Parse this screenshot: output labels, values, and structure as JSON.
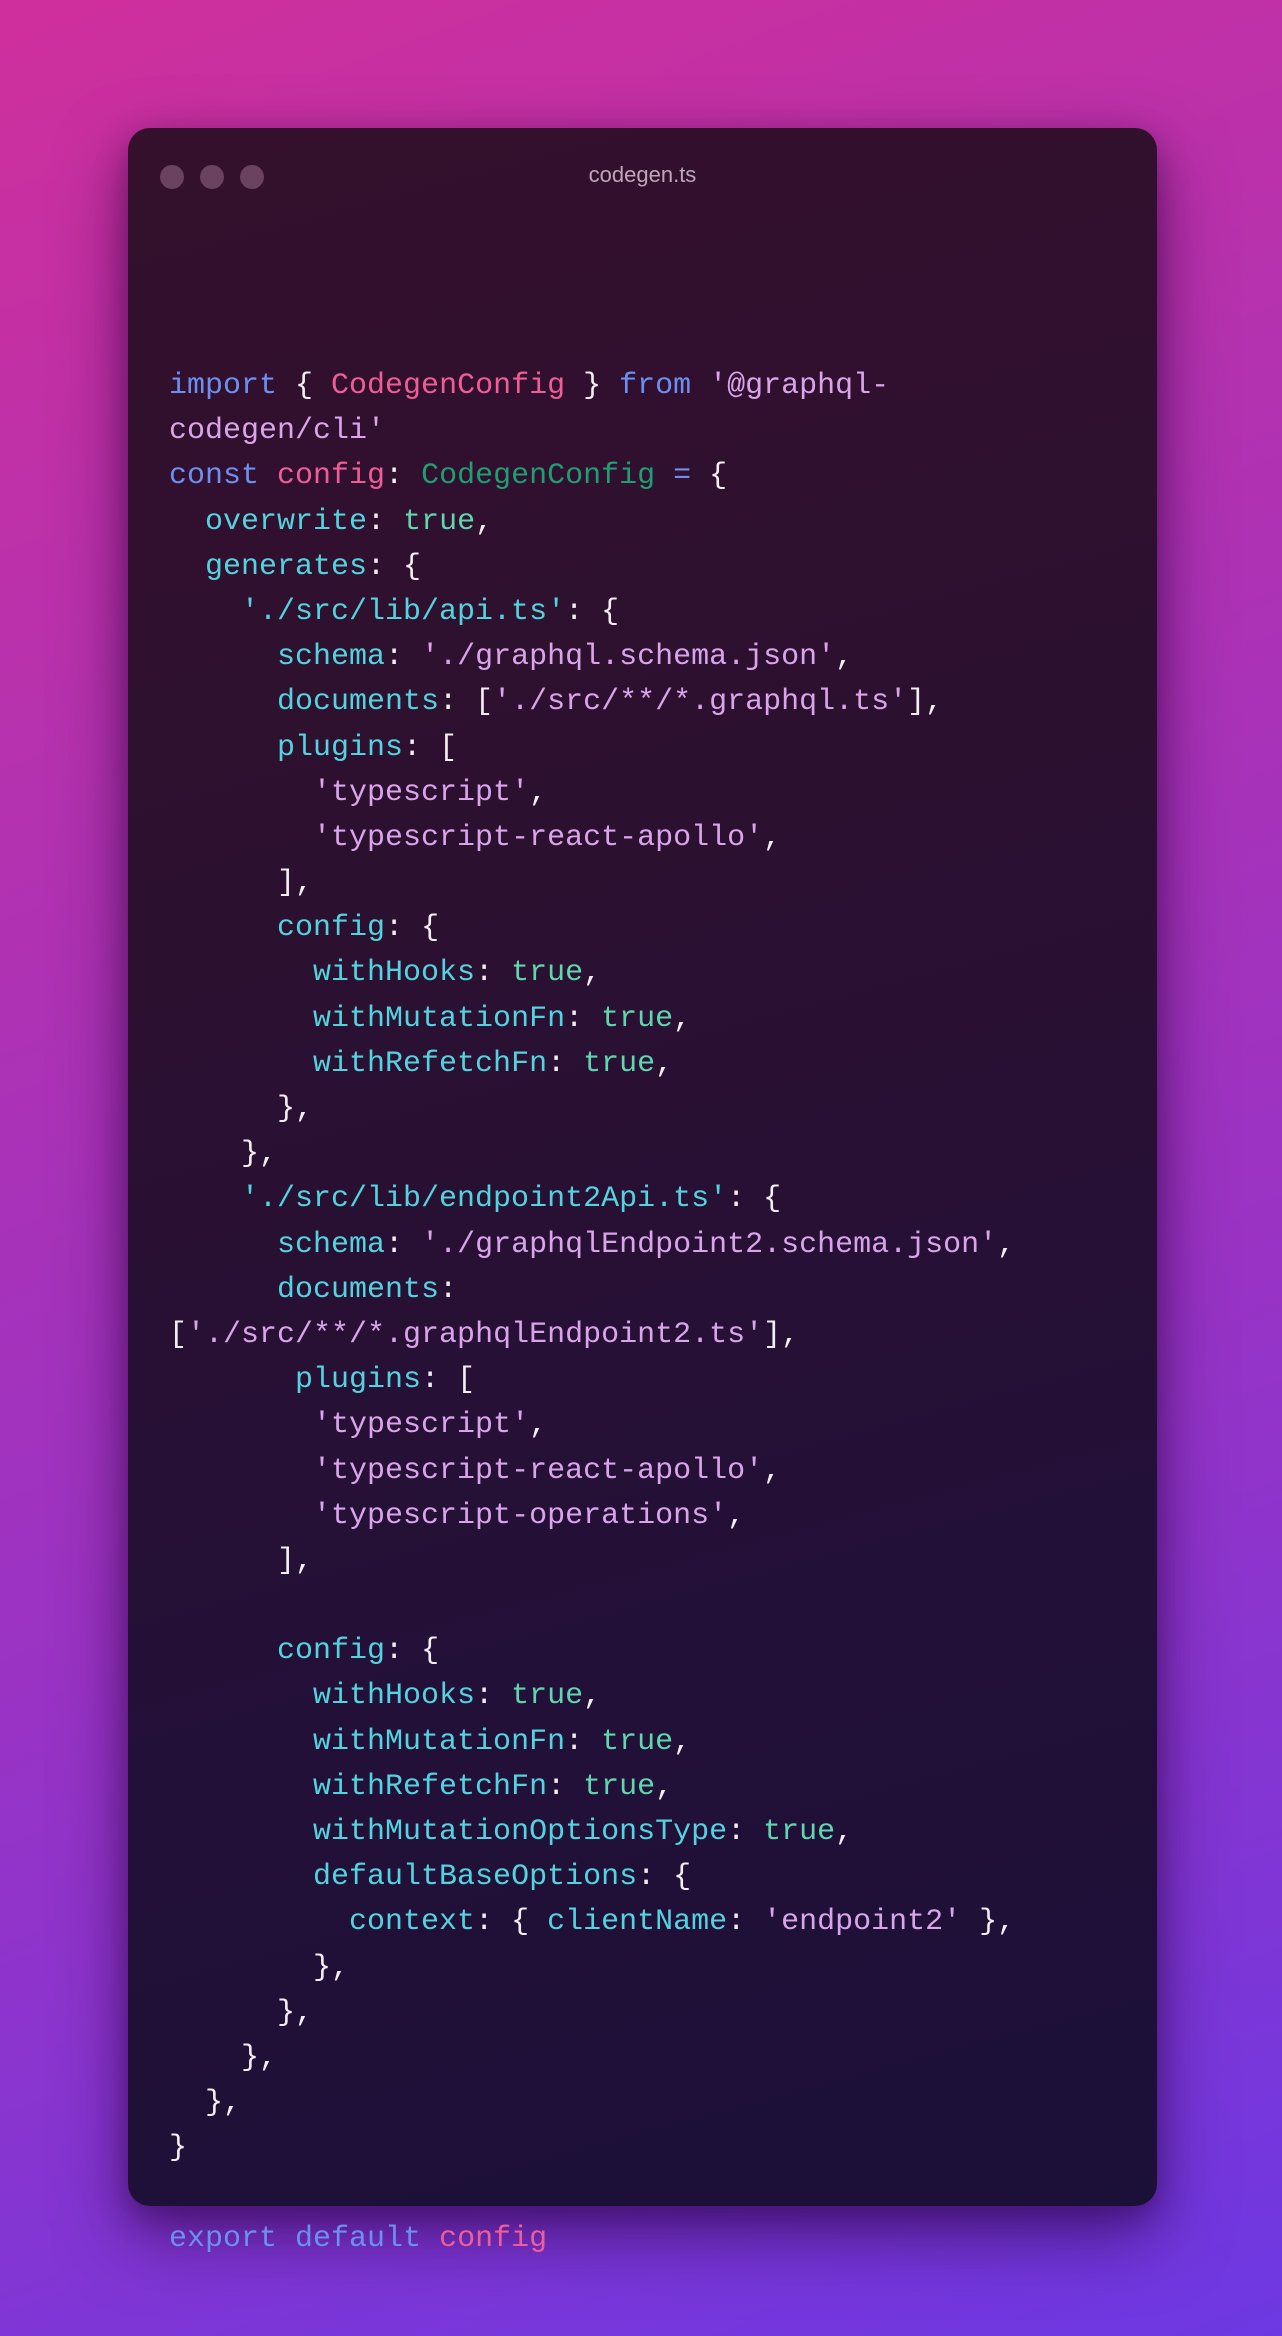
{
  "window": {
    "title": "codegen.ts",
    "controls": [
      "close",
      "minimize",
      "maximize"
    ]
  },
  "colors": {
    "keyword": "#6d8ff0",
    "identifier": "#ef5d98",
    "type": "#1f9e72",
    "property": "#52d3dd",
    "string": "#d9a4ea",
    "boolean": "#5fd6ad",
    "punctuation": "#f4eef2"
  },
  "code": {
    "language": "typescript",
    "lines": [
      [
        [
          "kw",
          "import"
        ],
        [
          "pun",
          " { "
        ],
        [
          "tp",
          "CodegenConfig"
        ],
        [
          "pun",
          " } "
        ],
        [
          "kw",
          "from"
        ],
        [
          "pun",
          " "
        ],
        [
          "str",
          "'@graphql-"
        ]
      ],
      [
        [
          "str",
          "codegen/cli'"
        ]
      ],
      [
        [
          "kw",
          "const"
        ],
        [
          "pun",
          " "
        ],
        [
          "tp",
          "config"
        ],
        [
          "pun",
          ": "
        ],
        [
          "ty",
          "CodegenConfig"
        ],
        [
          "pun",
          " "
        ],
        [
          "kw",
          "="
        ],
        [
          "pun",
          " {"
        ]
      ],
      [
        [
          "pun",
          "  "
        ],
        [
          "prop",
          "overwrite"
        ],
        [
          "pun",
          ": "
        ],
        [
          "bool",
          "true"
        ],
        [
          "pun",
          ","
        ]
      ],
      [
        [
          "pun",
          "  "
        ],
        [
          "prop",
          "generates"
        ],
        [
          "pun",
          ": {"
        ]
      ],
      [
        [
          "pun",
          "    "
        ],
        [
          "prop",
          "'./src/lib/api.ts'"
        ],
        [
          "pun",
          ": {"
        ]
      ],
      [
        [
          "pun",
          "      "
        ],
        [
          "prop",
          "schema"
        ],
        [
          "pun",
          ": "
        ],
        [
          "str",
          "'./graphql.schema.json'"
        ],
        [
          "pun",
          ","
        ]
      ],
      [
        [
          "pun",
          "      "
        ],
        [
          "prop",
          "documents"
        ],
        [
          "pun",
          ": ["
        ],
        [
          "str",
          "'./src/**/*.graphql.ts'"
        ],
        [
          "pun",
          "],"
        ]
      ],
      [
        [
          "pun",
          "      "
        ],
        [
          "prop",
          "plugins"
        ],
        [
          "pun",
          ": ["
        ]
      ],
      [
        [
          "pun",
          "        "
        ],
        [
          "str",
          "'typescript'"
        ],
        [
          "pun",
          ","
        ]
      ],
      [
        [
          "pun",
          "        "
        ],
        [
          "str",
          "'typescript-react-apollo'"
        ],
        [
          "pun",
          ","
        ]
      ],
      [
        [
          "pun",
          "      ],"
        ]
      ],
      [
        [
          "pun",
          "      "
        ],
        [
          "prop",
          "config"
        ],
        [
          "pun",
          ": {"
        ]
      ],
      [
        [
          "pun",
          "        "
        ],
        [
          "prop",
          "withHooks"
        ],
        [
          "pun",
          ": "
        ],
        [
          "bool",
          "true"
        ],
        [
          "pun",
          ","
        ]
      ],
      [
        [
          "pun",
          "        "
        ],
        [
          "prop",
          "withMutationFn"
        ],
        [
          "pun",
          ": "
        ],
        [
          "bool",
          "true"
        ],
        [
          "pun",
          ","
        ]
      ],
      [
        [
          "pun",
          "        "
        ],
        [
          "prop",
          "withRefetchFn"
        ],
        [
          "pun",
          ": "
        ],
        [
          "bool",
          "true"
        ],
        [
          "pun",
          ","
        ]
      ],
      [
        [
          "pun",
          "      },"
        ]
      ],
      [
        [
          "pun",
          "    },"
        ]
      ],
      [
        [
          "pun",
          "    "
        ],
        [
          "prop",
          "'./src/lib/endpoint2Api.ts'"
        ],
        [
          "pun",
          ": {"
        ]
      ],
      [
        [
          "pun",
          "      "
        ],
        [
          "prop",
          "schema"
        ],
        [
          "pun",
          ": "
        ],
        [
          "str",
          "'./graphqlEndpoint2.schema.json'"
        ],
        [
          "pun",
          ","
        ]
      ],
      [
        [
          "pun",
          "      "
        ],
        [
          "prop",
          "documents"
        ],
        [
          "pun",
          ":"
        ]
      ],
      [
        [
          "pun",
          "["
        ],
        [
          "str",
          "'./src/**/*.graphqlEndpoint2.ts'"
        ],
        [
          "pun",
          "],"
        ]
      ],
      [
        [
          "pun",
          "       "
        ],
        [
          "prop",
          "plugins"
        ],
        [
          "pun",
          ": ["
        ]
      ],
      [
        [
          "pun",
          "        "
        ],
        [
          "str",
          "'typescript'"
        ],
        [
          "pun",
          ","
        ]
      ],
      [
        [
          "pun",
          "        "
        ],
        [
          "str",
          "'typescript-react-apollo'"
        ],
        [
          "pun",
          ","
        ]
      ],
      [
        [
          "pun",
          "        "
        ],
        [
          "str",
          "'typescript-operations'"
        ],
        [
          "pun",
          ","
        ]
      ],
      [
        [
          "pun",
          "      ],"
        ]
      ],
      [],
      [
        [
          "pun",
          "      "
        ],
        [
          "prop",
          "config"
        ],
        [
          "pun",
          ": {"
        ]
      ],
      [
        [
          "pun",
          "        "
        ],
        [
          "prop",
          "withHooks"
        ],
        [
          "pun",
          ": "
        ],
        [
          "bool",
          "true"
        ],
        [
          "pun",
          ","
        ]
      ],
      [
        [
          "pun",
          "        "
        ],
        [
          "prop",
          "withMutationFn"
        ],
        [
          "pun",
          ": "
        ],
        [
          "bool",
          "true"
        ],
        [
          "pun",
          ","
        ]
      ],
      [
        [
          "pun",
          "        "
        ],
        [
          "prop",
          "withRefetchFn"
        ],
        [
          "pun",
          ": "
        ],
        [
          "bool",
          "true"
        ],
        [
          "pun",
          ","
        ]
      ],
      [
        [
          "pun",
          "        "
        ],
        [
          "prop",
          "withMutationOptionsType"
        ],
        [
          "pun",
          ": "
        ],
        [
          "bool",
          "true"
        ],
        [
          "pun",
          ","
        ]
      ],
      [
        [
          "pun",
          "        "
        ],
        [
          "prop",
          "defaultBaseOptions"
        ],
        [
          "pun",
          ": {"
        ]
      ],
      [
        [
          "pun",
          "          "
        ],
        [
          "prop",
          "context"
        ],
        [
          "pun",
          ": { "
        ],
        [
          "prop",
          "clientName"
        ],
        [
          "pun",
          ": "
        ],
        [
          "str",
          "'endpoint2'"
        ],
        [
          "pun",
          " },"
        ]
      ],
      [
        [
          "pun",
          "        },"
        ]
      ],
      [
        [
          "pun",
          "      },"
        ]
      ],
      [
        [
          "pun",
          "    },"
        ]
      ],
      [
        [
          "pun",
          "  },"
        ]
      ],
      [
        [
          "pun",
          "}"
        ]
      ],
      [],
      [
        [
          "kw",
          "export"
        ],
        [
          "pun",
          " "
        ],
        [
          "kw",
          "default"
        ],
        [
          "pun",
          " "
        ],
        [
          "tp",
          "config"
        ]
      ]
    ]
  }
}
